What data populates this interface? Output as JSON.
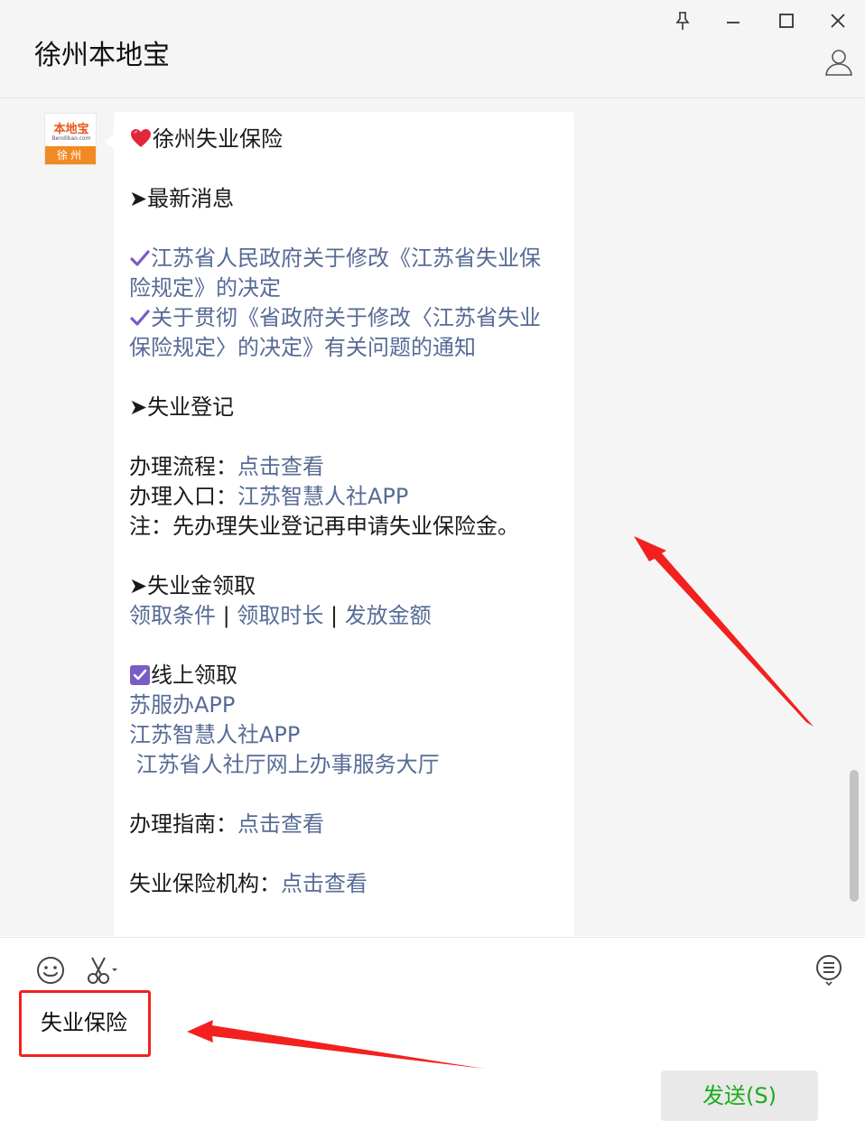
{
  "window": {
    "title": "徐州本地宝",
    "controls": [
      "pin-icon",
      "minimize-icon",
      "maximize-icon",
      "close-icon"
    ]
  },
  "contact": {
    "avatar_top": "本地宝",
    "avatar_sub": "Bendibao.com",
    "avatar_city": "徐州"
  },
  "message": {
    "title": "徐州失业保险",
    "section1_heading": "➤最新消息",
    "news1_line1": "江苏省人民政府关于修改《江苏省失业保",
    "news1_line2": "险规定》的决定",
    "news2_line1": "关于贯彻《省政府关于修改〈江苏省失业",
    "news2_line2": "保险规定〉的决定》有关问题的通知",
    "section2_heading": "➤失业登记",
    "process_label": "办理流程：",
    "process_link": "点击查看",
    "entry_label": "办理入口：",
    "entry_link": "江苏智慧人社APP",
    "note": "注：先办理失业登记再申请失业保险金。",
    "section3_heading": "➤失业金领取",
    "claim_link1": "领取条件",
    "claim_sep1": " | ",
    "claim_link2": "领取时长",
    "claim_sep2": " | ",
    "claim_link3": "发放金额",
    "online_heading": "线上领取",
    "online_link1": "苏服办APP",
    "online_link2": "江苏智慧人社APP",
    "online_link3": " 江苏省人社厅网上办事服务大厅",
    "guide_label": "办理指南：",
    "guide_link": "点击查看",
    "org_label": "失业保险机构：",
    "org_link": "点击查看"
  },
  "toolbar": {
    "icons": [
      "emoji-icon",
      "scissors-icon",
      "chat-history-icon"
    ]
  },
  "input": {
    "value": "失业保险"
  },
  "send_button": {
    "label": "发送(S)"
  },
  "colors": {
    "link": "#576b95",
    "send_text": "#1aad19",
    "annotation": "#f2211f",
    "check": "#7a5bc7"
  }
}
